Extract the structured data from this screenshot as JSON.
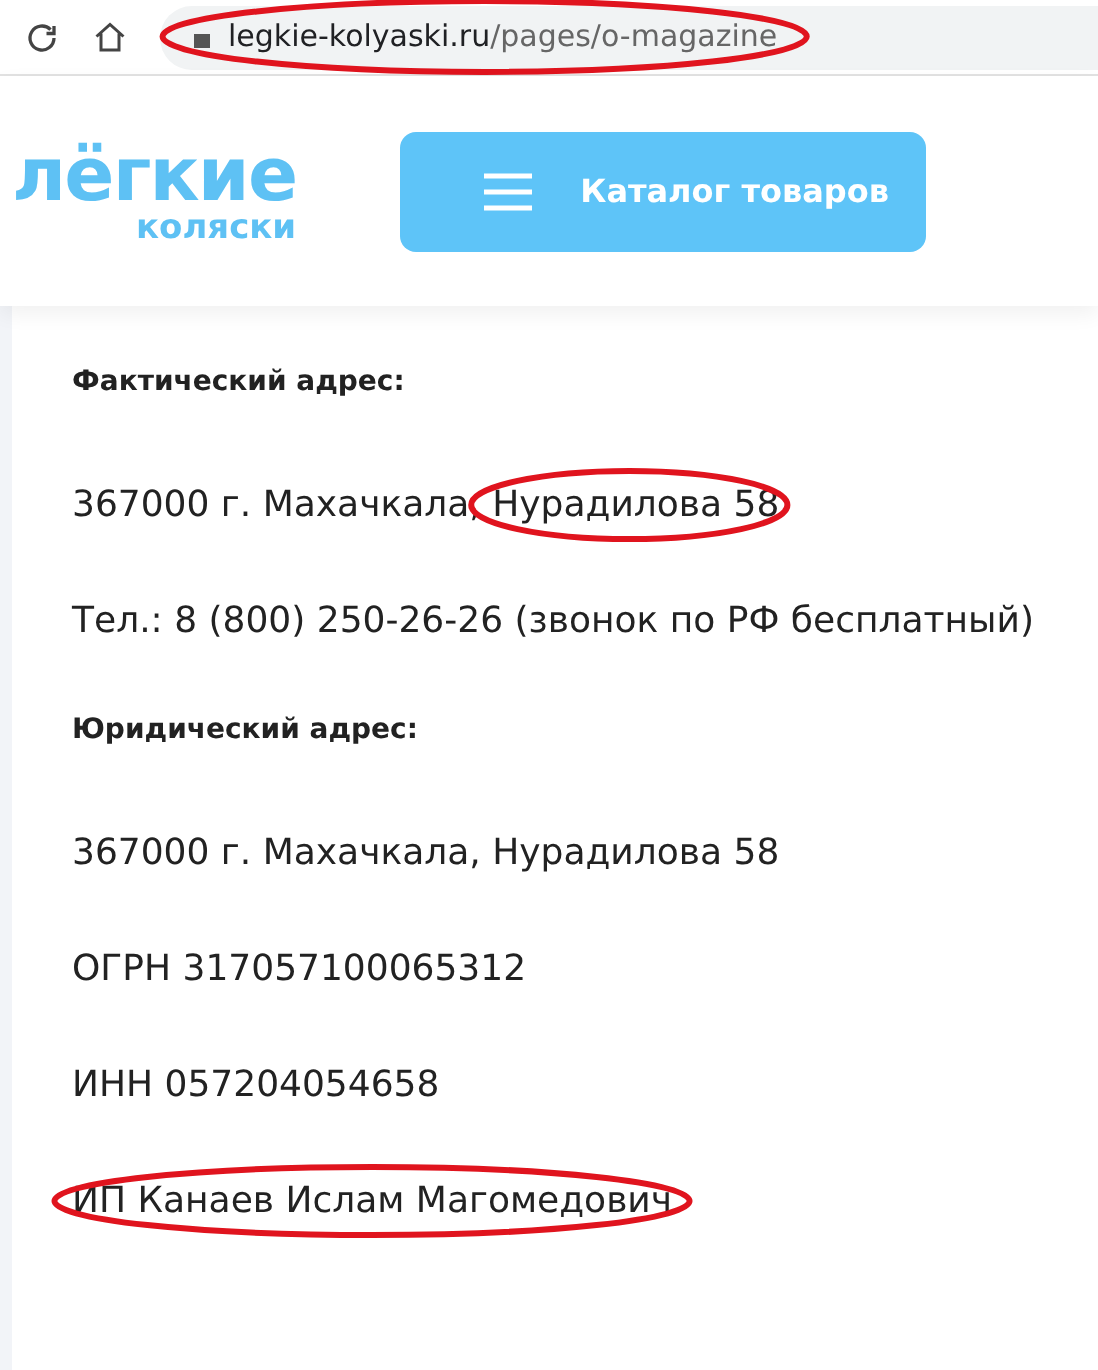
{
  "browser": {
    "url_host": "legkie-kolyaski.ru",
    "url_path": "/pages/o-magazine",
    "circled": true
  },
  "header": {
    "logo_top": "лёгкие",
    "logo_bottom": "коляски",
    "catalog_button": "Каталог товаров"
  },
  "lines": [
    {
      "kind": "heading",
      "parts": [
        {
          "text": "Фактический адрес:",
          "circled": false
        }
      ]
    },
    {
      "kind": "text",
      "parts": [
        {
          "text": "367000 г. Махачкала,",
          "circled": false
        },
        {
          "text": "Нурадилова 58",
          "circled": true
        }
      ]
    },
    {
      "kind": "text",
      "parts": [
        {
          "text": "Тел.: 8 (800) 250-26-26 (звонок по РФ бесплатный)",
          "circled": false
        }
      ]
    },
    {
      "kind": "heading",
      "parts": [
        {
          "text": "Юридический адрес:",
          "circled": false
        }
      ]
    },
    {
      "kind": "text",
      "parts": [
        {
          "text": "367000 г. Махачкала, Нурадилова 58",
          "circled": false
        }
      ]
    },
    {
      "kind": "text",
      "parts": [
        {
          "text": "ОГРН 317057100065312",
          "circled": false
        }
      ]
    },
    {
      "kind": "text",
      "parts": [
        {
          "text": "ИНН 057204054658",
          "circled": false
        }
      ]
    },
    {
      "kind": "text",
      "parts": [
        {
          "text": "ИП Канаев Ислам Магомедович",
          "circled": true
        }
      ]
    }
  ]
}
